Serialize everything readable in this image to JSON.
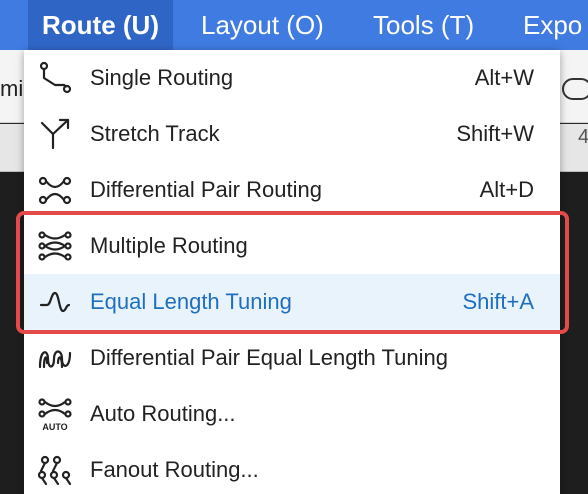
{
  "menubar": {
    "items": [
      {
        "label": "Route (U)"
      },
      {
        "label": "Layout (O)"
      },
      {
        "label": "Tools (T)"
      },
      {
        "label": "Expo"
      }
    ]
  },
  "background": {
    "unit_text": "mil",
    "ruler_text": "4"
  },
  "route_menu": {
    "items": [
      {
        "label": "Single Routing",
        "shortcut": "Alt+W",
        "icon": "single-routing-icon"
      },
      {
        "label": "Stretch Track",
        "shortcut": "Shift+W",
        "icon": "stretch-track-icon"
      },
      {
        "label": "Differential Pair Routing",
        "shortcut": "Alt+D",
        "icon": "differential-pair-routing-icon"
      },
      {
        "label": "Multiple Routing",
        "shortcut": "",
        "icon": "multiple-routing-icon"
      },
      {
        "label": "Equal Length Tuning",
        "shortcut": "Shift+A",
        "icon": "equal-length-tuning-icon"
      },
      {
        "label": "Differential Pair Equal Length Tuning",
        "shortcut": "",
        "icon": "differential-pair-equal-length-tuning-icon"
      },
      {
        "label": "Auto Routing...",
        "shortcut": "",
        "icon": "auto-routing-icon",
        "icon_text": "AUTO"
      },
      {
        "label": "Fanout Routing...",
        "shortcut": "",
        "icon": "fanout-routing-icon"
      }
    ],
    "highlighted_item": "Equal Length Tuning",
    "highlight_color": "#e8f3fb",
    "highlight_text_color": "#1f6fc0"
  },
  "annotation": {
    "color": "#e34a4a"
  },
  "menubar_color": "#3f7be0"
}
